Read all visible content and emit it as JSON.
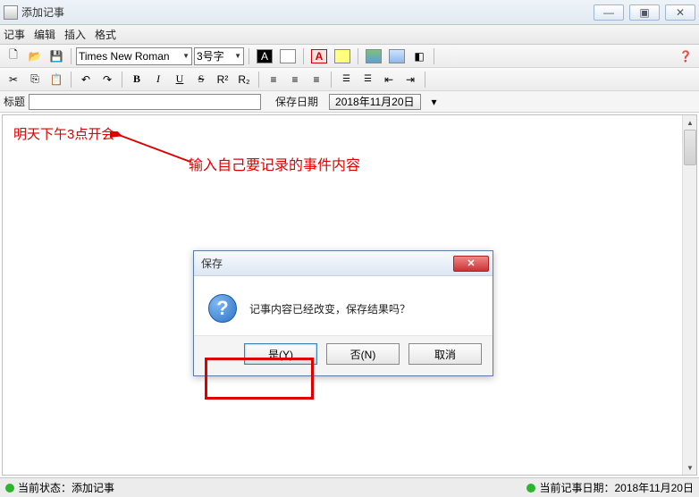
{
  "window": {
    "title": "添加记事"
  },
  "menu": {
    "items": [
      "记事",
      "编辑",
      "插入",
      "格式"
    ]
  },
  "toolbar1": {
    "font_name": "Times New Roman",
    "font_size_label": "3号字"
  },
  "titlerow": {
    "title_label": "标题",
    "save_date_label": "保存日期",
    "date_value": "2018年11月20日"
  },
  "editor": {
    "content": "明天下午3点开会",
    "annotation": "输入自己要记录的事件内容"
  },
  "dialog": {
    "title": "保存",
    "message": "记事内容已经改变，保存结果吗？",
    "yes": "是(Y)",
    "no": "否(N)",
    "cancel": "取消"
  },
  "status": {
    "left_label": "当前状态：",
    "left_value": "添加记事",
    "right_label": "当前记事日期：",
    "right_value": "2018年11月20日"
  }
}
